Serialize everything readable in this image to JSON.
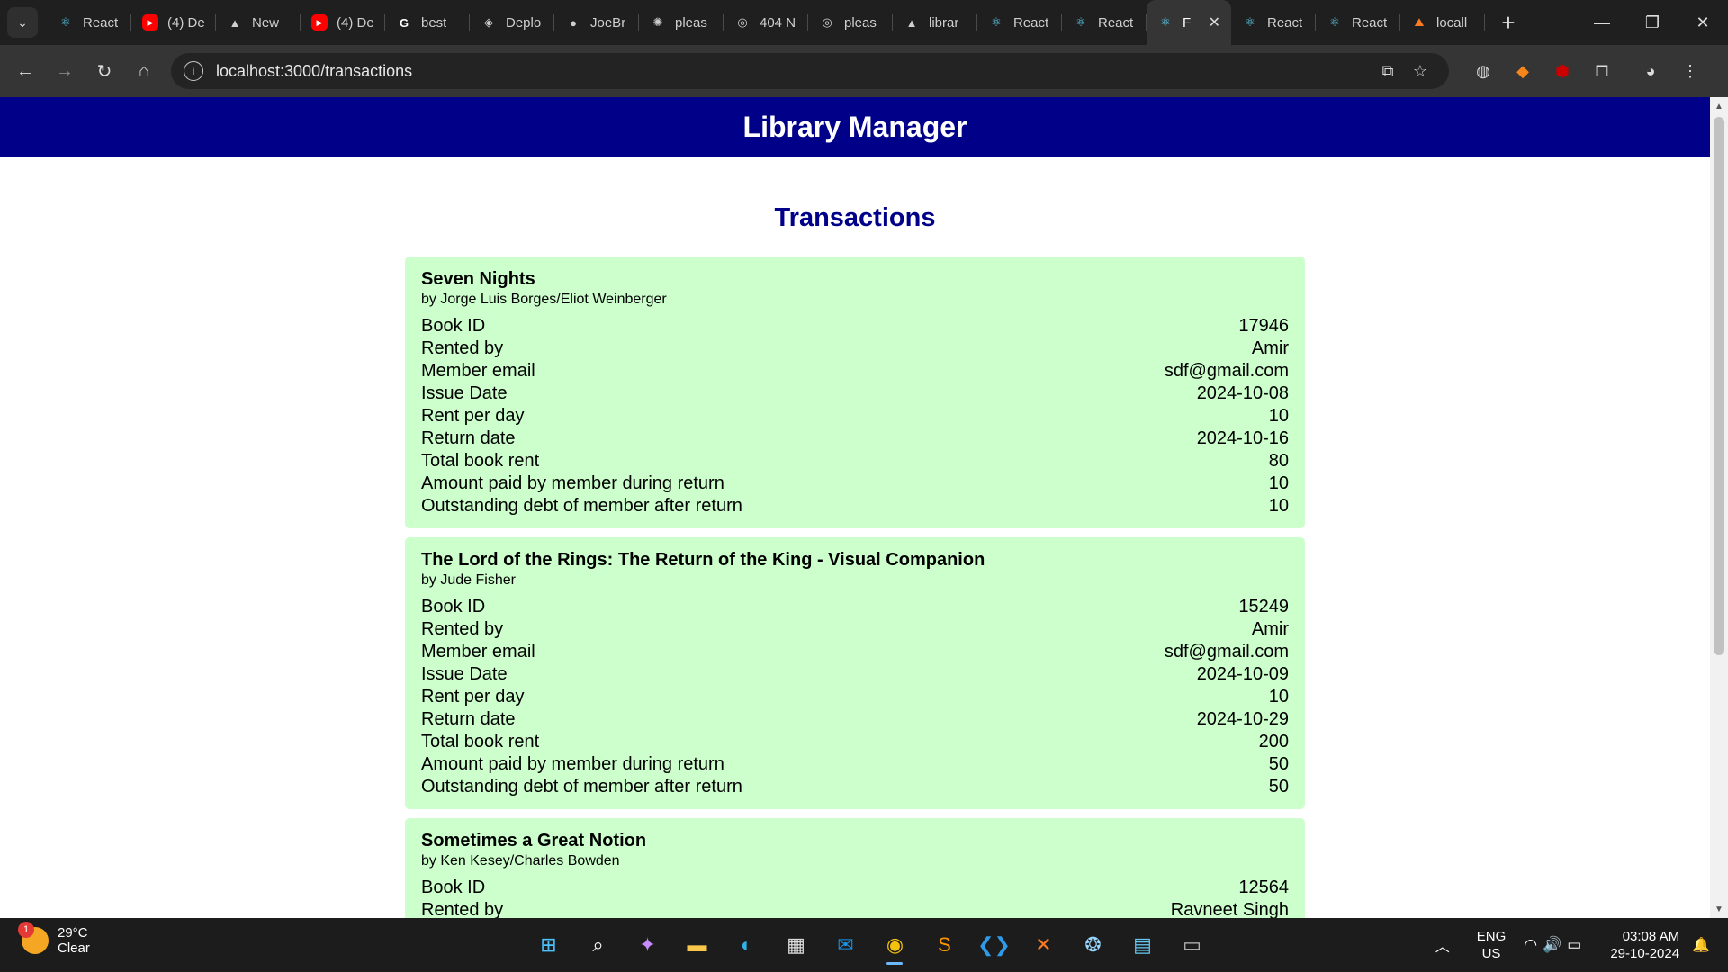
{
  "browser": {
    "tabs": [
      {
        "icon": "react-icon",
        "glyph": "⚛",
        "label": "React"
      },
      {
        "icon": "youtube-icon",
        "glyph": "▶",
        "label": "(4) De"
      },
      {
        "icon": "vercel-icon",
        "glyph": "▲",
        "label": "New"
      },
      {
        "icon": "youtube-icon",
        "glyph": "▶",
        "label": "(4) De"
      },
      {
        "icon": "google-icon",
        "glyph": "G",
        "label": "best"
      },
      {
        "icon": "deploy-icon",
        "glyph": "◈",
        "label": "Deplo"
      },
      {
        "icon": "github-icon",
        "glyph": "●",
        "label": "JoeBr"
      },
      {
        "icon": "openai-icon",
        "glyph": "✺",
        "label": "pleas"
      },
      {
        "icon": "globe-icon",
        "glyph": "◎",
        "label": "404 N"
      },
      {
        "icon": "globe-icon",
        "glyph": "◎",
        "label": "pleas"
      },
      {
        "icon": "vercel-icon",
        "glyph": "▲",
        "label": "librar"
      },
      {
        "icon": "react-icon",
        "glyph": "⚛",
        "label": "React"
      },
      {
        "icon": "react-icon",
        "glyph": "⚛",
        "label": "React"
      },
      {
        "icon": "react-icon",
        "glyph": "⚛",
        "label": "F",
        "active": true
      },
      {
        "icon": "react-icon",
        "glyph": "⚛",
        "label": "React"
      },
      {
        "icon": "react-icon",
        "glyph": "⚛",
        "label": "React"
      },
      {
        "icon": "xampp-icon",
        "glyph": "⛰",
        "label": "locall"
      }
    ],
    "url": "localhost:3000/transactions"
  },
  "app": {
    "title": "Library Manager",
    "section_title": "Transactions"
  },
  "transactions": [
    {
      "title": "Seven Nights",
      "author": "by Jorge Luis Borges/Eliot Weinberger",
      "rows": [
        {
          "label": "Book ID",
          "value": "17946"
        },
        {
          "label": "Rented by",
          "value": "Amir"
        },
        {
          "label": "Member email",
          "value": "sdf@gmail.com"
        },
        {
          "label": "Issue Date",
          "value": "2024-10-08"
        },
        {
          "label": "Rent per day",
          "value": "10"
        },
        {
          "label": "Return date",
          "value": "2024-10-16"
        },
        {
          "label": "Total book rent",
          "value": "80"
        },
        {
          "label": "Amount paid by member during return",
          "value": "10"
        },
        {
          "label": "Outstanding debt of member after return",
          "value": "10"
        }
      ]
    },
    {
      "title": "The Lord of the Rings: The Return of the King - Visual Companion",
      "author": "by Jude Fisher",
      "rows": [
        {
          "label": "Book ID",
          "value": "15249"
        },
        {
          "label": "Rented by",
          "value": "Amir"
        },
        {
          "label": "Member email",
          "value": "sdf@gmail.com"
        },
        {
          "label": "Issue Date",
          "value": "2024-10-09"
        },
        {
          "label": "Rent per day",
          "value": "10"
        },
        {
          "label": "Return date",
          "value": "2024-10-29"
        },
        {
          "label": "Total book rent",
          "value": "200"
        },
        {
          "label": "Amount paid by member during return",
          "value": "50"
        },
        {
          "label": "Outstanding debt of member after return",
          "value": "50"
        }
      ]
    },
    {
      "title": "Sometimes a Great Notion",
      "author": "by Ken Kesey/Charles Bowden",
      "rows": [
        {
          "label": "Book ID",
          "value": "12564"
        },
        {
          "label": "Rented by",
          "value": "Ravneet Singh"
        }
      ]
    }
  ],
  "taskbar": {
    "weather_badge": "1",
    "temperature": "29°C",
    "condition": "Clear",
    "lang_top": "ENG",
    "lang_bottom": "US",
    "time": "03:08 AM",
    "date": "29-10-2024",
    "apps": [
      {
        "icon": "windows-start-icon",
        "glyph": "⊞"
      },
      {
        "icon": "search-icon",
        "glyph": "⌕"
      },
      {
        "icon": "copilot-icon",
        "glyph": "✦"
      },
      {
        "icon": "file-explorer-icon",
        "glyph": "▬"
      },
      {
        "icon": "edge-icon",
        "glyph": "◐"
      },
      {
        "icon": "store-icon",
        "glyph": "▦"
      },
      {
        "icon": "outlook-icon",
        "glyph": "✉"
      },
      {
        "icon": "chrome-icon",
        "glyph": "◉",
        "active": true
      },
      {
        "icon": "sublime-icon",
        "glyph": "S"
      },
      {
        "icon": "vscode-icon",
        "glyph": "❮❯"
      },
      {
        "icon": "xampp-icon",
        "glyph": "✕"
      },
      {
        "icon": "app-icon",
        "glyph": "❂"
      },
      {
        "icon": "notepad-icon",
        "glyph": "▤"
      },
      {
        "icon": "terminal-icon",
        "glyph": "▭"
      }
    ]
  }
}
